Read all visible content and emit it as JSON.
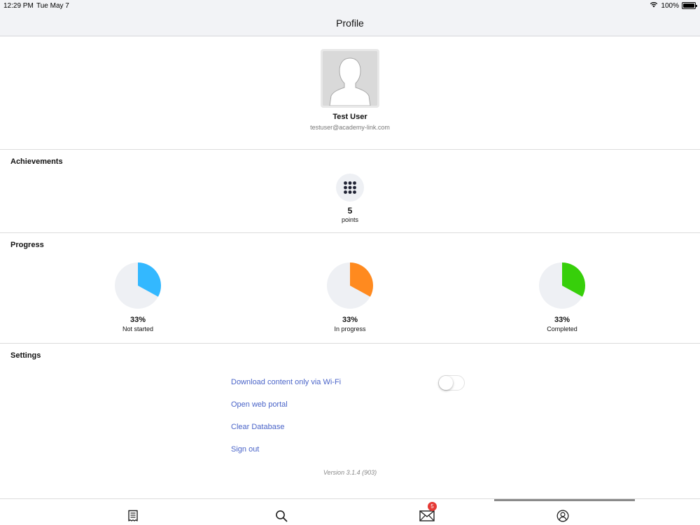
{
  "status_bar": {
    "time": "12:29 PM",
    "date": "Tue May 7",
    "battery": "100%"
  },
  "nav": {
    "title": "Profile"
  },
  "profile": {
    "name": "Test User",
    "email": "testuser@academy-link.com"
  },
  "achievements": {
    "title": "Achievements",
    "value": "5",
    "label": "points",
    "icon": "grid-dots-icon"
  },
  "progress": {
    "title": "Progress",
    "items": [
      {
        "percent": "33%",
        "label": "Not started",
        "fraction": 0.33,
        "color": "#33b8ff"
      },
      {
        "percent": "33%",
        "label": "In progress",
        "fraction": 0.33,
        "color": "#ff8a1f"
      },
      {
        "percent": "33%",
        "label": "Completed",
        "fraction": 0.33,
        "color": "#37cf0a"
      }
    ],
    "track_color": "#eef0f4"
  },
  "settings": {
    "title": "Settings",
    "wifi_label": "Download content only via Wi-Fi",
    "wifi_enabled": false,
    "web_portal": "Open web portal",
    "clear_db": "Clear Database",
    "sign_out": "Sign out",
    "version": "Version 3.1.4 (903)"
  },
  "tabbar": {
    "tabs": [
      "receipt-icon",
      "search-icon",
      "mail-icon",
      "profile-icon"
    ],
    "mail_badge": "5",
    "active_tab": "profile-icon"
  },
  "colors": {
    "link": "#4a64c8",
    "badge": "#e53935"
  }
}
